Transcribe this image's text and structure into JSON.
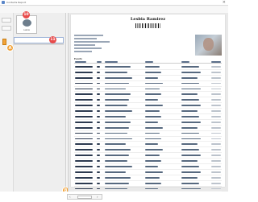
{
  "window": {
    "title": "Contacts Report"
  },
  "document": {
    "title": "Lesbia Ramirez"
  },
  "thumbnail": {
    "label": "Lesbia"
  },
  "badges": {
    "step_10": "10",
    "step_11": "11",
    "step_a": "A",
    "step_b": "B"
  },
  "table": {
    "title": "Events",
    "rows": [
      "r1",
      "r2",
      "r3",
      "r4",
      "r5",
      "r6",
      "r7",
      "r8",
      "r9",
      "r10",
      "r11",
      "r12",
      "r13",
      "r14",
      "r15",
      "r16",
      "r17",
      "r18",
      "r19",
      "r20",
      "r21",
      "r22",
      "r23",
      "r24"
    ]
  },
  "colors": {
    "badge_red": "#e84a4a",
    "badge_orange": "#f2a33a",
    "selection_border": "#9fb4d8"
  },
  "icons": [
    "app-icon",
    "close-icon",
    "avatar-thumbnail",
    "photo",
    "barcode",
    "prev-page-icon",
    "next-page-icon"
  ]
}
